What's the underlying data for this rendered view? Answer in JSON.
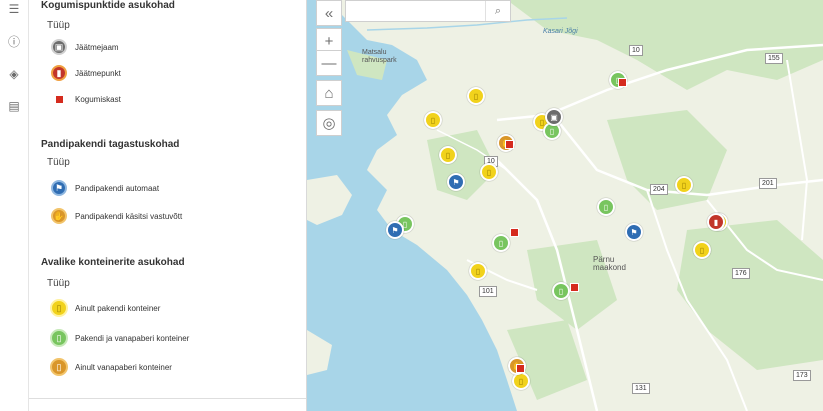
{
  "sidebar_rail": {
    "icons": [
      "legend-icon",
      "info-icon",
      "layers-icon",
      "description-icon"
    ]
  },
  "legend": {
    "cards": [
      {
        "title": "Kogumispunktide asukohad",
        "type_label": "Tüüp",
        "items": [
          {
            "label": "Jäätmejaam",
            "icon": "waste-station-icon",
            "color": "#6c6c6c"
          },
          {
            "label": "Jäätmepunkt",
            "icon": "waste-point-icon",
            "color": "#c2352a"
          },
          {
            "label": "Kogumiskast",
            "icon": "collection-box-icon",
            "color": "#d52b1e"
          }
        ]
      },
      {
        "title": "Pandipakendi tagastuskohad",
        "type_label": "Tüüp",
        "items": [
          {
            "label": "Pandipakendi automaat",
            "icon": "deposit-machine-icon",
            "color": "#2f6db3"
          },
          {
            "label": "Pandipakendi käsitsi vastuvõtt",
            "icon": "manual-return-icon",
            "color": "#d9962a"
          }
        ]
      },
      {
        "title": "Avalike konteinerite asukohad",
        "type_label": "Tüüp",
        "items": [
          {
            "label": "Ainult pakendi konteiner",
            "icon": "bin-icon",
            "color": "#f1d21c"
          },
          {
            "label": "Pakendi ja vanapaberi konteiner",
            "icon": "bin-icon",
            "color": "#78c55f"
          },
          {
            "label": "Ainult vanapaberi konteiner",
            "icon": "bin-icon",
            "color": "#d9962a"
          }
        ]
      }
    ]
  },
  "map": {
    "labels": {
      "park": "Matsalu\nrahvuspark",
      "kasari": "Kasari Jõgi",
      "parnu": "Pärnu\nmaakond"
    },
    "road_shields": [
      "10",
      "155",
      "10",
      "204",
      "201",
      "176",
      "101",
      "131",
      "173"
    ],
    "colors": {
      "water": "#a8d5e8",
      "land": "#eef1e4",
      "forest": "#cfe6c1",
      "road": "#ffffff"
    }
  },
  "map_controls": {
    "collapse_icon": "double-chevron-left-icon",
    "zoom_in_icon": "plus-icon",
    "zoom_out_icon": "minus-icon",
    "home_icon": "home-icon",
    "locate_icon": "locate-icon",
    "search_placeholder": "",
    "search_icon": "search-icon"
  }
}
